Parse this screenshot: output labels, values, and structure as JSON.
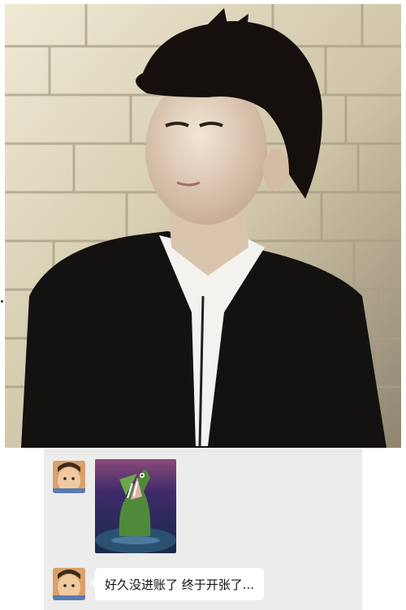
{
  "chat": {
    "messages": [
      {
        "type": "sticker",
        "sticker_icon": "crocodile-sticker-icon",
        "avatar_icon": "baby-avatar-icon"
      },
      {
        "type": "text",
        "text": "好久没进账了 终于开张了...",
        "avatar_icon": "baby-avatar-icon"
      }
    ]
  },
  "colors": {
    "chat_background": "#ececec",
    "bubble_background": "#ffffff"
  }
}
